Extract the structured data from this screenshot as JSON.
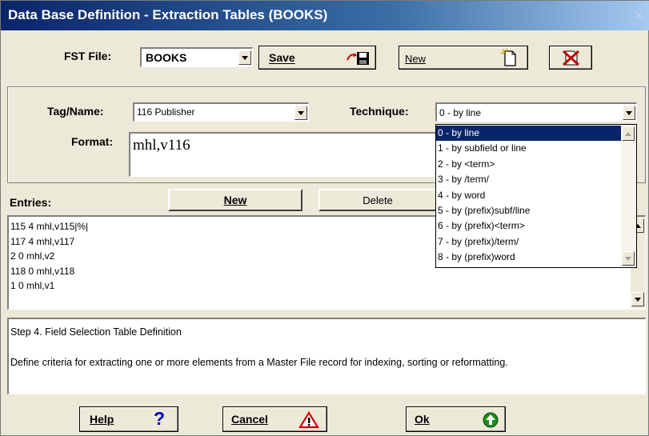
{
  "window": {
    "title": "Data Base Definition - Extraction Tables (BOOKS)",
    "close_glyph": "×"
  },
  "fst": {
    "label": "FST File:",
    "value": "BOOKS",
    "save_label": "Save",
    "new_label": "New"
  },
  "tag": {
    "label": "Tag/Name:",
    "value": "116 Publisher"
  },
  "technique": {
    "label": "Technique:",
    "value": "0 - by line",
    "options": [
      "0 - by line",
      "1 - by subfield or line",
      "2 - by <term>",
      "3 - by /term/",
      "4 - by word",
      "5 - by (prefix)subf/line",
      "6 - by (prefix)<term>",
      "7 - by (prefix)/term/",
      "8 - by (prefix)word"
    ],
    "selected_index": 0
  },
  "format": {
    "label": "Format:",
    "value": "mhl,v116"
  },
  "entries": {
    "label": "Entries:",
    "new_label": "New",
    "delete_label": "Delete",
    "items": [
      "115 4 mhl,v115|%|",
      "117 4 mhl,v117",
      "2 0 mhl,v2",
      "118 0 mhl,v118",
      "1 0 mhl,v1"
    ]
  },
  "help_text": {
    "step": "Step 4. Field Selection Table Definition",
    "description": "Define criteria for extracting one or more elements from a Master File record for indexing, sorting or reformatting."
  },
  "footer": {
    "help_label": "Help",
    "cancel_label": "Cancel",
    "ok_label": "Ok"
  },
  "icons": {
    "save": "floppy-disk-icon",
    "new": "new-document-icon",
    "delete_fst": "delete-file-icon",
    "help": "question-mark-icon",
    "cancel": "warning-triangle-icon",
    "ok": "green-arrow-up-icon"
  },
  "colors": {
    "title_start": "#0a246a",
    "title_end": "#a6caf0",
    "selection": "#0a246a",
    "ok_icon": "#1e8a1e",
    "cancel_icon": "#d40000"
  }
}
